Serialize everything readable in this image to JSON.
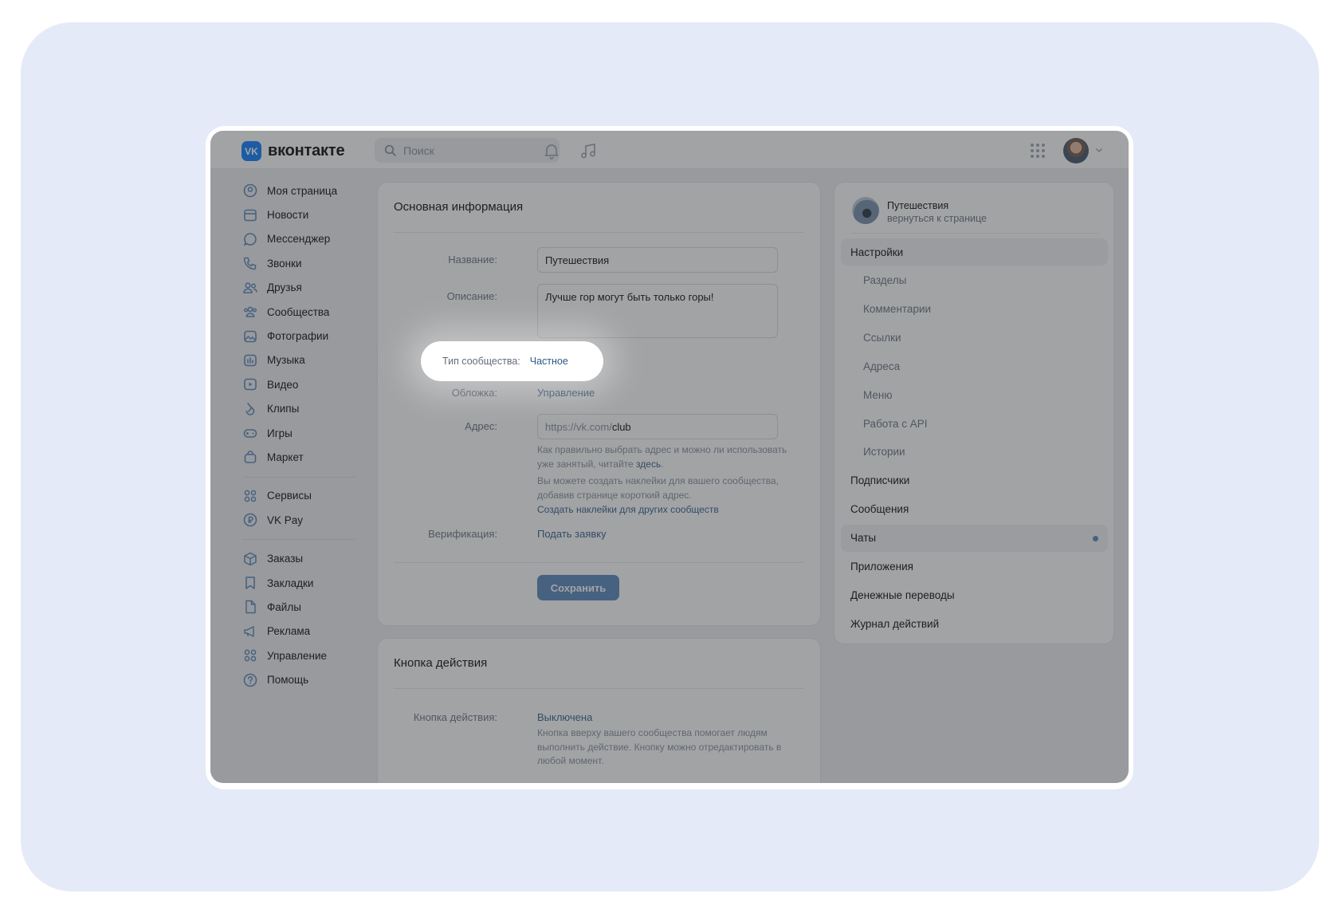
{
  "header": {
    "logo_mark": "VK",
    "logo_text": "вконтакте",
    "search_placeholder": "Поиск"
  },
  "nav": {
    "group1": [
      "Моя страница",
      "Новости",
      "Мессенджер",
      "Звонки",
      "Друзья",
      "Сообщества",
      "Фотографии",
      "Музыка",
      "Видео",
      "Клипы",
      "Игры",
      "Маркет"
    ],
    "group2": [
      "Сервисы",
      "VK Pay"
    ],
    "group3": [
      "Заказы",
      "Закладки",
      "Файлы",
      "Реклама",
      "Управление",
      "Помощь"
    ]
  },
  "main_info": {
    "title": "Основная информация",
    "name_label": "Название:",
    "name_value": "Путешествия",
    "desc_label": "Описание:",
    "desc_value": "Лучше гор могут быть только горы!",
    "type_label": "Тип сообщества:",
    "type_value": "Частное",
    "cover_label": "Обложка:",
    "cover_value": "Управление",
    "address_label": "Адрес:",
    "address_prefix": "https://vk.com/",
    "address_value": "club",
    "hint1_text": "Как правильно выбрать адрес и можно ли использовать уже занятый, читайте",
    "hint1_link": "здесь",
    "hint2_text": "Вы можете создать наклейки для вашего сообщества, добавив странице короткий адрес.",
    "hint2_link": "Создать наклейки для других сообществ",
    "verify_label": "Верификация:",
    "verify_value": "Подать заявку",
    "save_label": "Сохранить"
  },
  "action_card": {
    "title": "Кнопка действия",
    "label": "Кнопка действия:",
    "value": "Выключена",
    "hint": "Кнопка вверху вашего сообщества помогает людям выполнить действие. Кнопку можно отредактировать в любой момент."
  },
  "right_menu": {
    "group_name": "Путешествия",
    "group_back": "вернуться к странице",
    "items": [
      {
        "label": "Настройки",
        "sub": false,
        "active": true
      },
      {
        "label": "Разделы",
        "sub": true
      },
      {
        "label": "Комментарии",
        "sub": true
      },
      {
        "label": "Ссылки",
        "sub": true
      },
      {
        "label": "Адреса",
        "sub": true
      },
      {
        "label": "Меню",
        "sub": true
      },
      {
        "label": "Работа с API",
        "sub": true
      },
      {
        "label": "Истории",
        "sub": true
      },
      {
        "label": "Подписчики",
        "sub": false
      },
      {
        "label": "Сообщения",
        "sub": false
      },
      {
        "label": "Чаты",
        "sub": false,
        "active": true,
        "dot": true
      },
      {
        "label": "Приложения",
        "sub": false
      },
      {
        "label": "Денежные переводы",
        "sub": false
      },
      {
        "label": "Журнал действий",
        "sub": false
      }
    ]
  },
  "colors": {
    "accent": "#0077ff",
    "link": "#2a5885",
    "button": "#5181b8",
    "backdrop": "#e4eaf7"
  }
}
